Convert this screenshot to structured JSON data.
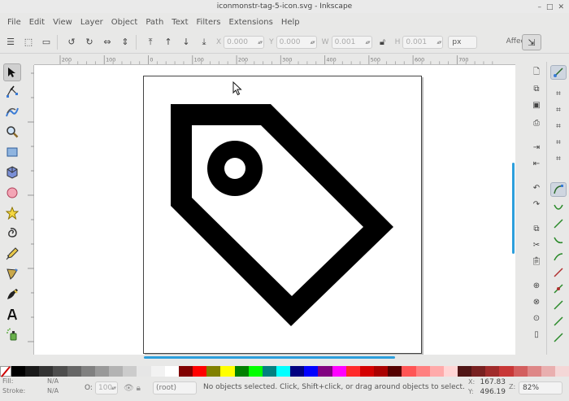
{
  "window": {
    "title": "iconmonstr-tag-5-icon.svg - Inkscape",
    "minimize": "–",
    "maximize": "□",
    "close": "✕"
  },
  "menu": [
    "File",
    "Edit",
    "View",
    "Layer",
    "Object",
    "Path",
    "Text",
    "Filters",
    "Extensions",
    "Help"
  ],
  "toolbar": {
    "x_label": "X",
    "x_value": "0.000",
    "y_label": "Y",
    "y_value": "0.000",
    "w_label": "W",
    "w_value": "0.001",
    "h_label": "H",
    "h_value": "0.001",
    "unit": "px",
    "affect_label": "Affect:"
  },
  "ruler": {
    "h_ticks": [
      "200",
      "100",
      "0",
      "100",
      "200",
      "300",
      "400",
      "500",
      "600",
      "700"
    ]
  },
  "palette": [
    "#000000",
    "#1a1a1a",
    "#333333",
    "#4d4d4d",
    "#666666",
    "#808080",
    "#999999",
    "#b3b3b3",
    "#cccccc",
    "#e6e6e6",
    "#f2f2f2",
    "#ffffff",
    "#800000",
    "#ff0000",
    "#808000",
    "#ffff00",
    "#008000",
    "#00ff00",
    "#008080",
    "#00ffff",
    "#000080",
    "#0000ff",
    "#800080",
    "#ff00ff",
    "#ff2a2a",
    "#d40000",
    "#aa0000",
    "#550000",
    "#ff5555",
    "#ff8080",
    "#ffaaaa",
    "#ffd5d5",
    "#501616",
    "#782121",
    "#a02c2c",
    "#c83737",
    "#d35f5f",
    "#de8787",
    "#e9afaf",
    "#f4d7d7"
  ],
  "status": {
    "fill_label": "Fill:",
    "fill_value": "N/A",
    "stroke_label": "Stroke:",
    "stroke_value": "N/A",
    "opacity_label": "O:",
    "opacity_value": "100",
    "layer": "(root)",
    "message": "No objects selected. Click, Shift+click, or drag around objects to select.",
    "x_label": "X:",
    "x_value": "167.83",
    "y_label": "Y:",
    "y_value": "496.19",
    "zoom_label": "Z:",
    "zoom_value": "82%"
  }
}
